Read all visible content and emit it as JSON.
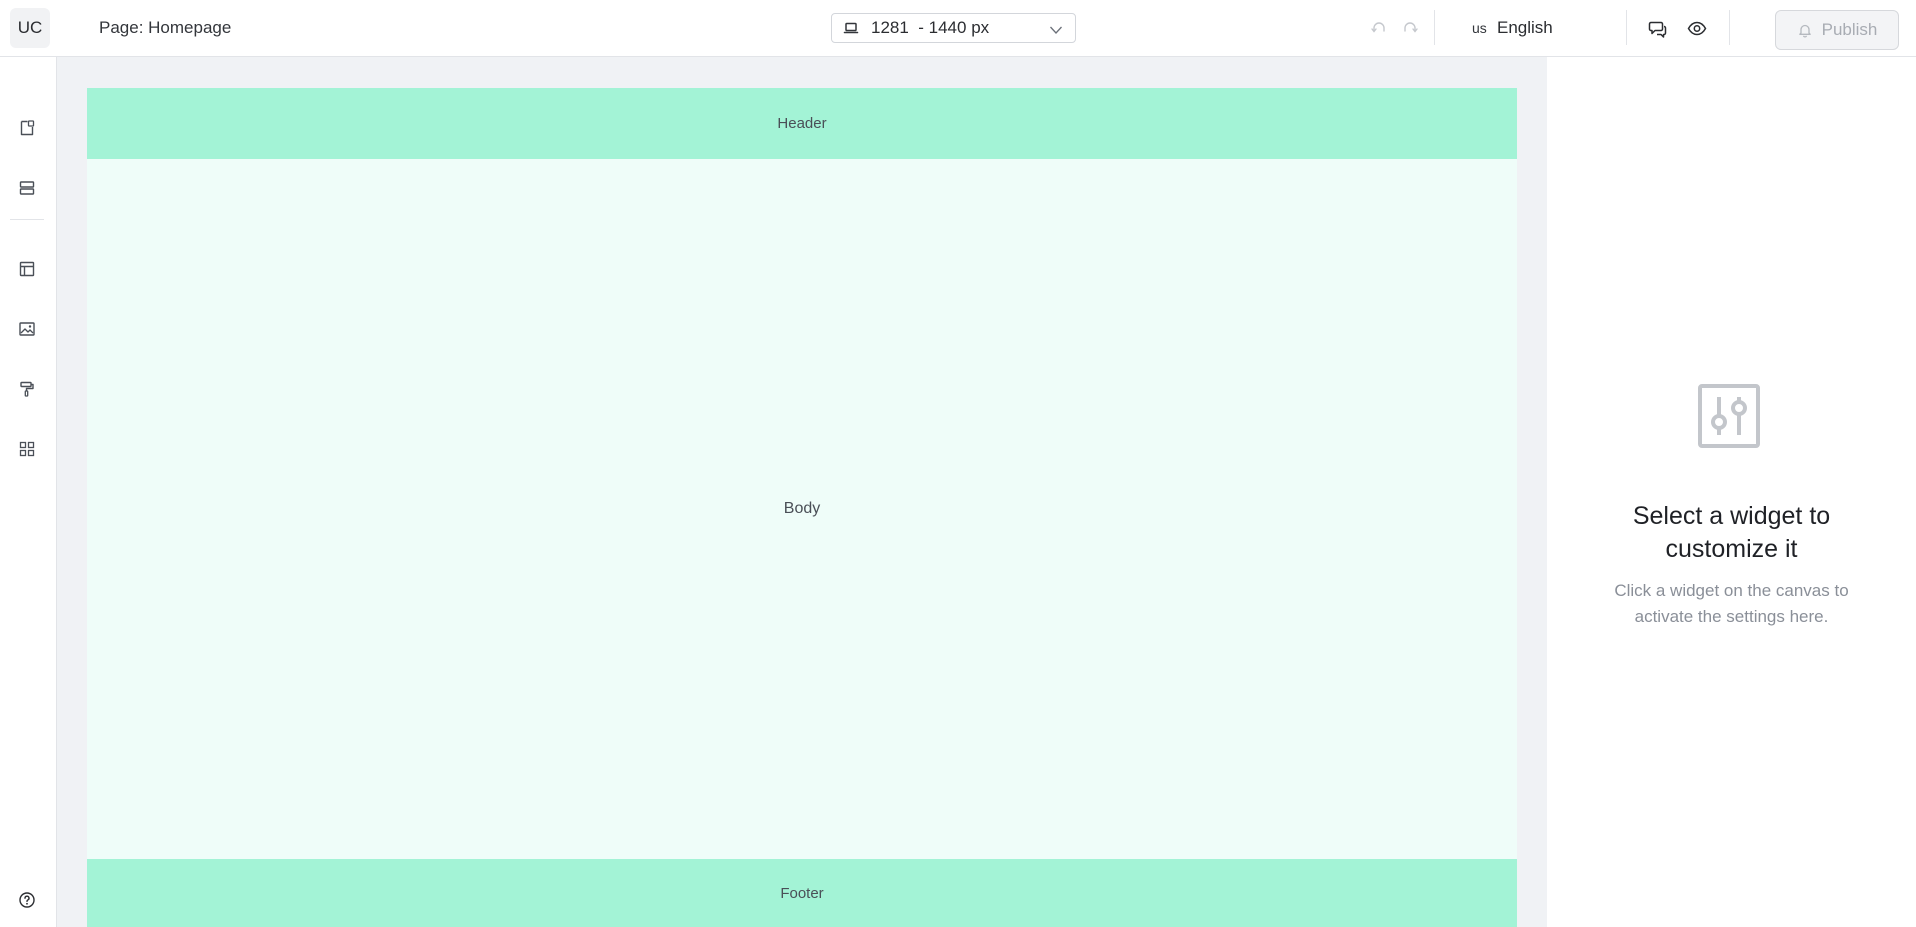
{
  "topbar": {
    "logo_text": "UC",
    "page_label": "Page: Homepage",
    "device": {
      "icon": "laptop-icon",
      "range": "1281  - 1440 px"
    },
    "undo_icon": "undo-icon",
    "redo_icon": "redo-icon",
    "language": {
      "code": "us",
      "name": "English"
    },
    "comments_icon": "comments-icon",
    "preview_icon": "eye-icon",
    "publish_label": "Publish",
    "publish_icon": "bell-icon"
  },
  "leftrail": {
    "items": [
      {
        "icon": "pages-icon"
      },
      {
        "icon": "sections-icon"
      },
      {
        "icon": "layout-icon"
      },
      {
        "icon": "image-icon"
      },
      {
        "icon": "paint-roller-icon"
      },
      {
        "icon": "widgets-grid-icon"
      }
    ],
    "help_icon": "help-icon"
  },
  "canvas": {
    "header_label": "Header",
    "body_label": "Body",
    "footer_label": "Footer",
    "colors": {
      "header_footer": "#a3f3d6",
      "body": "#effdf9",
      "canvas_bg": "#f0f2f5"
    }
  },
  "settings_panel": {
    "icon": "sliders-icon",
    "title_line1": "Select a widget to",
    "title_line2": "customize it",
    "subtitle_line1": "Click a widget on the canvas to",
    "subtitle_line2": "activate the settings here."
  }
}
